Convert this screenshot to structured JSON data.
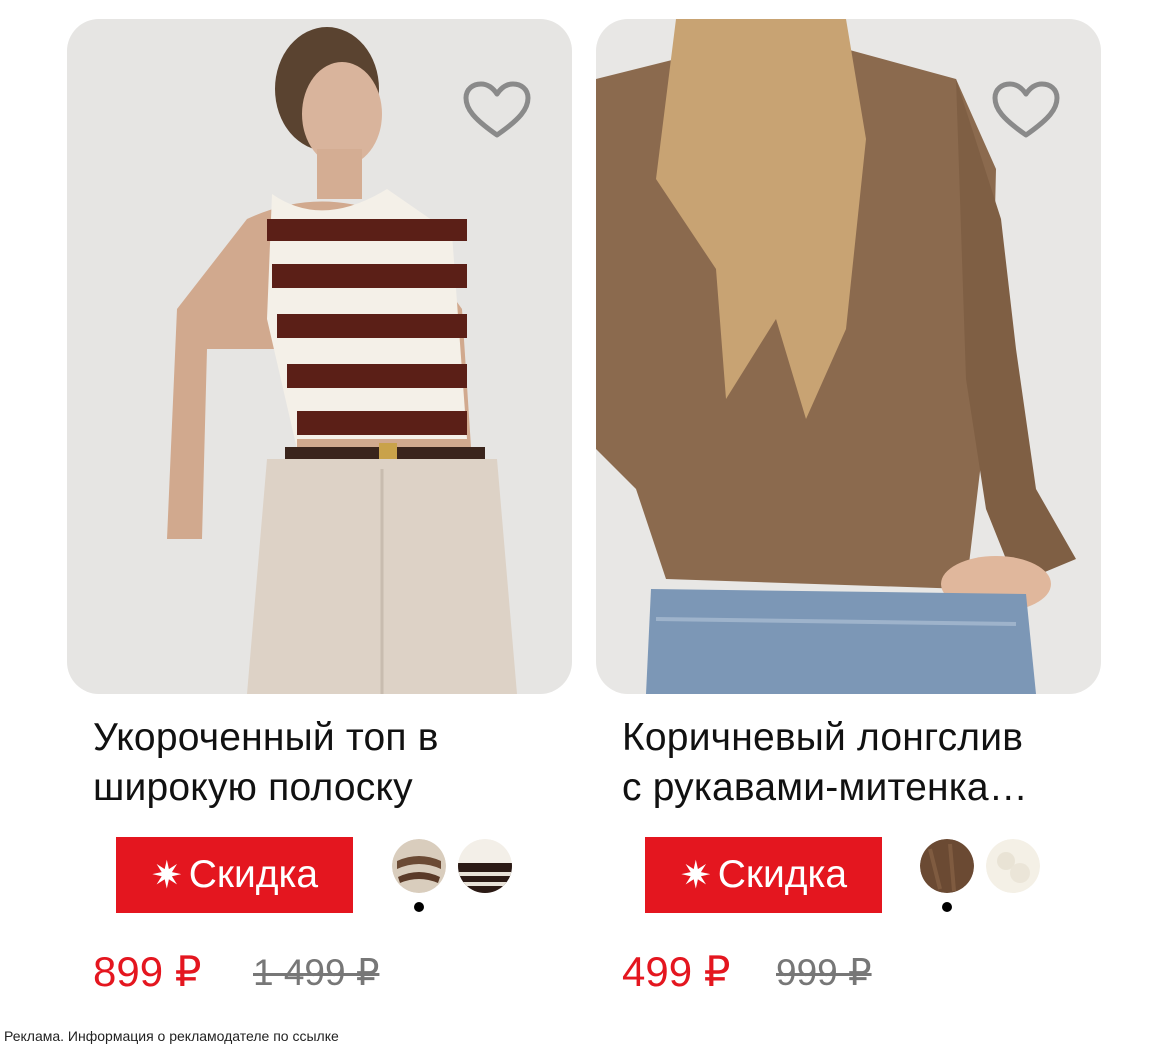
{
  "products": [
    {
      "title_line1": "Укороченный топ в",
      "title_line2": "широкую полоску",
      "badge": "Скидка",
      "badge_icon": "✷",
      "price": "899 ₽",
      "old_price": "1 499 ₽",
      "colors": [
        "beige-brown-stripe",
        "brown-white-stripe"
      ],
      "selected_color_index": 0,
      "favorite_icon": "heart-outline-icon"
    },
    {
      "title_line1": "Коричневый лонгслив",
      "title_line2": "с рукавами-митенка…",
      "badge": "Скидка",
      "badge_icon": "✷",
      "price": "499 ₽",
      "old_price": "999 ₽",
      "colors": [
        "brown",
        "cream"
      ],
      "selected_color_index": 0,
      "favorite_icon": "heart-outline-icon"
    }
  ],
  "footer": {
    "ad_notice": "Реклама. Информация о рекламодателе по ссылке"
  },
  "colors": {
    "accent_red": "#e4161f",
    "old_price_gray": "#777777"
  }
}
